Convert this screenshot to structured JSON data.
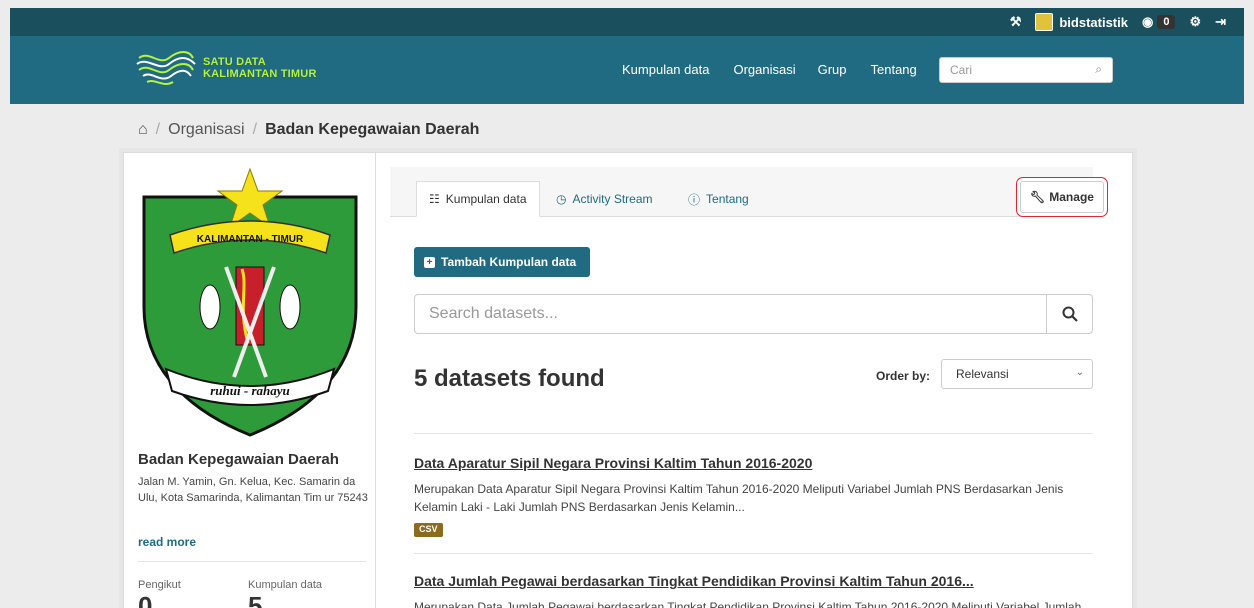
{
  "account": {
    "username": "bidstatistik",
    "dashboard_count": "0",
    "icons": [
      "sysadmin-icon",
      "dashboard-icon",
      "settings-icon",
      "logout-icon"
    ]
  },
  "logo": {
    "line1": "SATU DATA",
    "line2": "KALIMANTAN TIMUR"
  },
  "nav": {
    "items": [
      "Kumpulan data",
      "Organisasi",
      "Grup",
      "Tentang"
    ]
  },
  "search_top": {
    "placeholder": "Cari"
  },
  "breadcrumb": {
    "items": [
      "Organisasi",
      "Badan Kepegawaian Daerah"
    ]
  },
  "sidebar": {
    "emblem_banner": "KALIMANTAN - TIMUR",
    "emblem_motto": "ruhui - rahayu",
    "org_title": "Badan Kepegawaian Daerah",
    "org_description": "Jalan M. Yamin, Gn. Kelua, Kec. Samarin da Ulu, Kota Samarinda, Kalimantan Tim ur 75243",
    "read_more": "read more",
    "followers_label": "Pengikut",
    "followers_value": "0",
    "datasets_label": "Kumpulan data",
    "datasets_value": "5"
  },
  "tabs": [
    {
      "label": "Kumpulan data",
      "icon": "sitemap-icon"
    },
    {
      "label": "Activity Stream",
      "icon": "clock-icon"
    },
    {
      "label": "Tentang",
      "icon": "info-icon"
    }
  ],
  "manage": {
    "label": "Manage",
    "highlight_color": "#e0262c"
  },
  "add_dataset": {
    "label": "Tambah Kumpulan data"
  },
  "dataset_search": {
    "placeholder": "Search datasets..."
  },
  "results": {
    "count_text": "5 datasets found"
  },
  "order_by": {
    "label": "Order by:",
    "selected": "Relevansi"
  },
  "datasets": [
    {
      "title": "Data Aparatur Sipil Negara Provinsi Kaltim Tahun 2016-2020",
      "notes": "Merupakan Data Aparatur Sipil Negara Provinsi Kaltim Tahun 2016-2020 Meliputi Variabel Jumlah PNS Berdasarkan Jenis Kelamin Laki - Laki Jumlah PNS Berdasarkan Jenis Kelamin...",
      "format": "CSV"
    },
    {
      "title": "Data Jumlah Pegawai berdasarkan Tingkat Pendidikan Provinsi Kaltim Tahun 2016...",
      "notes": "Merupakan Data Jumlah Pegawai berdasarkan Tingkat Pendidikan Provinsi Kaltim Tahun 2016-2020 Meliputi Variabel Jumlah Tamat",
      "format": ""
    }
  ],
  "colors": {
    "brand": "#206b82",
    "account_bar": "#1a4f5e",
    "format_badge": "#8c6b1e"
  }
}
